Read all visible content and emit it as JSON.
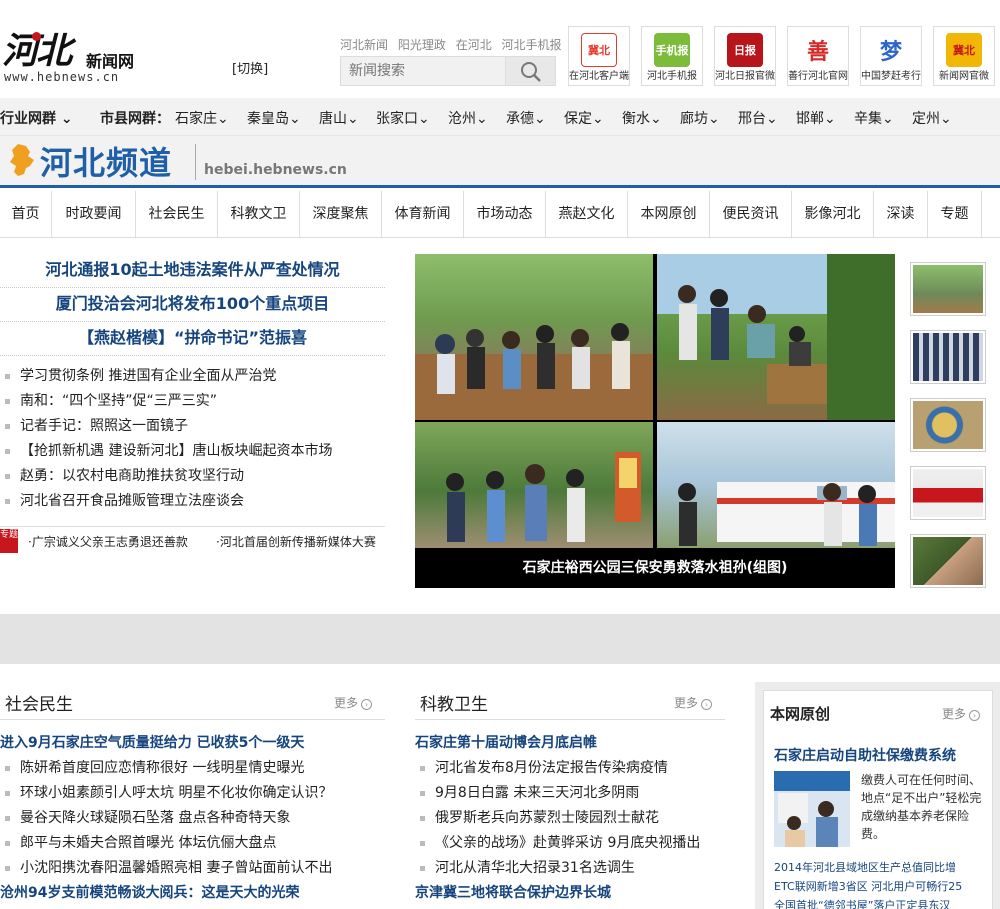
{
  "header": {
    "logo_big": "河北",
    "logo_small": "新闻网",
    "logo_url": "www.hebnews.cn",
    "switch_label": "[切换]",
    "top_links": [
      "河北新闻",
      "阳光理政",
      "在河北",
      "河北手机报"
    ],
    "search_placeholder": "新闻搜索",
    "apps": [
      {
        "label": "在河北客户端",
        "glyph": "冀北",
        "color": "#e53b2c"
      },
      {
        "label": "河北手机报",
        "glyph": "手机报",
        "color": "#7dbb3a"
      },
      {
        "label": "河北日报官微",
        "glyph": "日报",
        "color": "#b8141b"
      },
      {
        "label": "善行河北官网",
        "glyph": "善",
        "color": "#d42a2a"
      },
      {
        "label": "中国梦赶考行",
        "glyph": "梦",
        "color": "#2b67c9"
      },
      {
        "label": "新闻网官微",
        "glyph": "冀北",
        "color": "#f2b705"
      }
    ]
  },
  "regions": {
    "lead_label": "行业网群",
    "city_label": "市县网群：",
    "cities": [
      "石家庄",
      "秦皇岛",
      "唐山",
      "张家口",
      "沧州",
      "承德",
      "保定",
      "衡水",
      "廊坊",
      "邢台",
      "邯郸",
      "辛集",
      "定州"
    ]
  },
  "channel": {
    "name": "河北频道",
    "host": "hebei.hebnews.cn"
  },
  "nav": [
    "首页",
    "时政要闻",
    "社会民生",
    "科教文卫",
    "深度聚焦",
    "体育新闻",
    "市场动态",
    "燕赵文化",
    "本网原创",
    "便民资讯",
    "影像河北",
    "深读",
    "专题"
  ],
  "headlines": [
    "河北通报10起土地违法案件从严查处情况",
    "厦门投洽会河北将发布100个重点项目",
    "【燕赵楷模】“拼命书记”范振喜"
  ],
  "news_list": [
    "学习贯彻条例 推进国有企业全面从严治党",
    "南和：“四个坚持”促“三严三实”",
    "记者手记：照照这一面镜子",
    "【抢抓新机遇 建设新河北】唐山板块崛起资本市场",
    "赵勇：以农村电商助推扶贫攻坚行动",
    "河北省召开食品摊贩管理立法座谈会"
  ],
  "special": {
    "tag": "专题",
    "items": [
      "·广宗诚义父亲王志勇退还善款",
      "·河北首届创新传播新媒体大赛"
    ]
  },
  "slideshow": {
    "caption": "石家庄裕西公园三保安勇救落水祖孙(组图)"
  },
  "thumbnails": [
    "thumb-1",
    "thumb-2",
    "thumb-3",
    "thumb-4",
    "thumb-5"
  ],
  "sections": {
    "social": {
      "title": "社会民生",
      "more": "更多",
      "lead": "进入9月石家庄空气质量挺给力 已收获5个一级天",
      "items": [
        "陈妍希首度回应恋情称很好 一线明星情史曝光",
        "环球小姐素颜引人呼太坑 明星不化妆你确定认识？",
        "曼谷天降火球疑陨石坠落 盘点各种奇特天象",
        "郎平与未婚夫合照首曝光 体坛伉俪大盘点",
        "小沈阳携沈春阳温馨婚照亮相 妻子曾站面前认不出"
      ],
      "tail": "沧州94岁支前模范畅谈大阅兵：这是天大的光荣"
    },
    "science": {
      "title": "科教卫生",
      "more": "更多",
      "lead": "石家庄第十届动博会月底启帷",
      "items": [
        "河北省发布8月份法定报告传染病疫情",
        "9月8日白露 未来三天河北多阴雨",
        "俄罗斯老兵向苏蒙烈士陵园烈士献花",
        "《父亲的战场》赴黄骅采访 9月底央视播出",
        "河北从清华北大招录31名选调生"
      ],
      "tail": "京津冀三地将联合保护边界长城"
    },
    "original": {
      "title": "本网原创",
      "more": "更多",
      "lead": "石家庄启动自助社保缴费系统",
      "desc": "缴费人可在任何时间、地点“足不出户”轻松完成缴纳基本养老保险费。",
      "links": [
        "2014年河北县域地区生产总值同比增",
        "ETC联网新增3省区 河北用户可畅行25",
        "全国首批“德邻书屋”落户正定县东汉"
      ]
    }
  }
}
